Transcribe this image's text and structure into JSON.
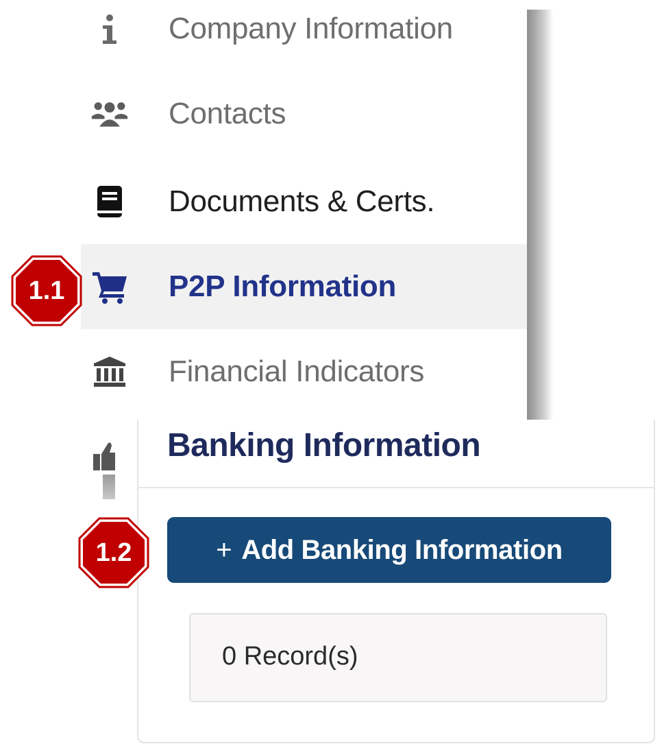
{
  "sidebar": {
    "items": [
      {
        "label": "Company Information",
        "icon": "info-icon"
      },
      {
        "label": "Contacts",
        "icon": "users-icon"
      },
      {
        "label": "Documents & Certs.",
        "icon": "book-icon"
      },
      {
        "label": "P2P Information",
        "icon": "cart-icon",
        "active": true
      },
      {
        "label": "Financial Indicators",
        "icon": "bank-icon"
      }
    ]
  },
  "badges": {
    "step_1": "1.1",
    "step_2": "1.2"
  },
  "banking": {
    "title": "Banking Information",
    "add_button_plus": "+",
    "add_button_label": "Add Banking Information",
    "records": "0 Record(s)"
  },
  "colors": {
    "active_label": "#22338a",
    "button_bg": "#174a78",
    "badge_red": "#c00000",
    "panel_title": "#1f2a5c"
  }
}
